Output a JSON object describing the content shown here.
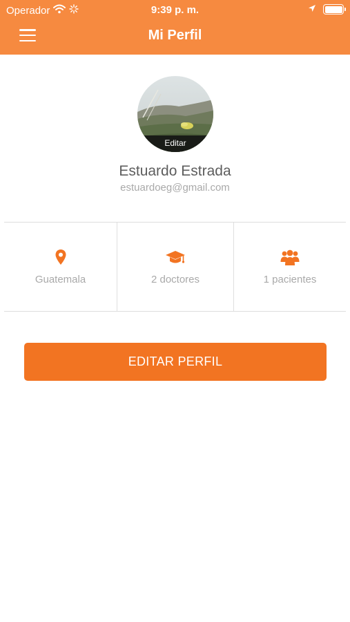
{
  "status_bar": {
    "carrier": "Operador",
    "time": "9:39 p. m."
  },
  "header": {
    "title": "Mi Perfil"
  },
  "profile": {
    "avatar_edit_label": "Editar",
    "name": "Estuardo Estrada",
    "email": "estuardoeg@gmail.com"
  },
  "stats": [
    {
      "icon": "location-pin-icon",
      "label": "Guatemala"
    },
    {
      "icon": "graduation-cap-icon",
      "label": "2 doctores"
    },
    {
      "icon": "group-icon",
      "label": "1 pacientes"
    }
  ],
  "actions": {
    "edit_profile_label": "EDITAR PERFIL"
  },
  "colors": {
    "header_bg": "#f68a40",
    "accent": "#f27422",
    "text_primary": "#5d5d5d",
    "text_secondary": "#a9a9a9"
  }
}
